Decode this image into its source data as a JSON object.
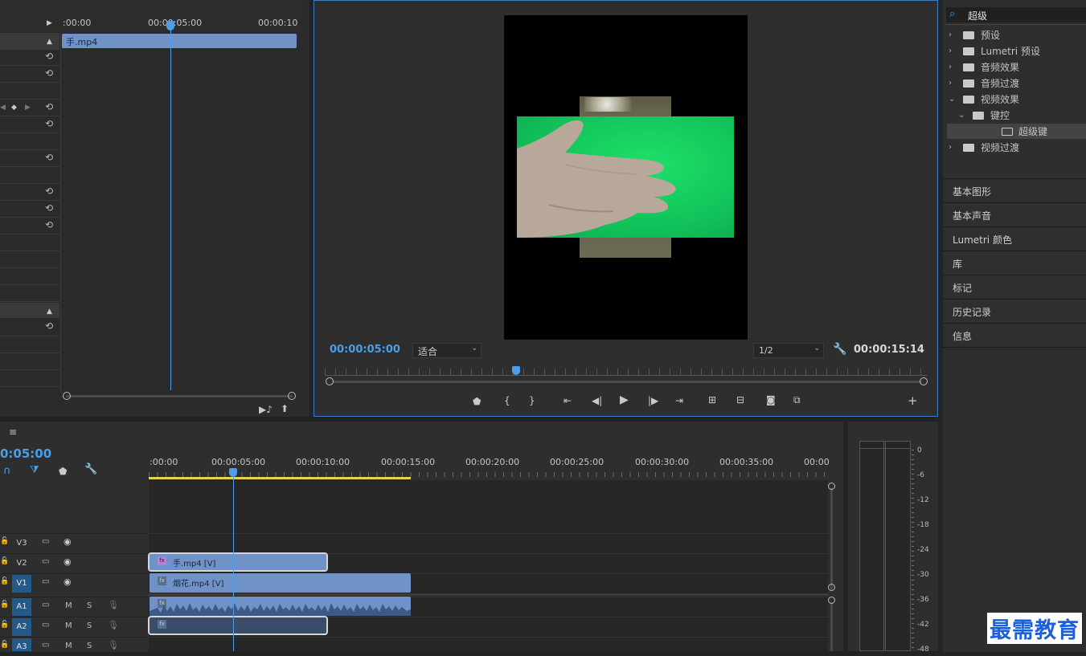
{
  "effect_controls": {
    "ruler": {
      "t0": ":00:00",
      "t5": "00:00:05:00",
      "t10": "00:00:10"
    },
    "clip_name": "手.mp4"
  },
  "program_monitor": {
    "timecode_current": "00:00:05:00",
    "fit_select": "适合",
    "resolution_select": "1/2",
    "timecode_duration": "00:00:15:14"
  },
  "effects_panel": {
    "search_value": "超级",
    "items": [
      {
        "label": "预设",
        "indent": 0
      },
      {
        "label": "Lumetri 预设",
        "indent": 0
      },
      {
        "label": "音频效果",
        "indent": 0
      },
      {
        "label": "音频过渡",
        "indent": 0
      },
      {
        "label": "视频效果",
        "indent": 0
      },
      {
        "label": "键控",
        "indent": 1
      },
      {
        "label": "超级键",
        "indent": 2
      },
      {
        "label": "视频过渡",
        "indent": 0
      }
    ]
  },
  "side_panels": [
    "基本图形",
    "基本声音",
    "Lumetri 颜色",
    "库",
    "标记",
    "历史记录",
    "信息"
  ],
  "timeline": {
    "timecode": "0:05:00",
    "ruler_labels": [
      ":00:00",
      "00:00:05:00",
      "00:00:10:00",
      "00:00:15:00",
      "00:00:20:00",
      "00:00:25:00",
      "00:00:30:00",
      "00:00:35:00",
      "00:00"
    ],
    "tracks": [
      {
        "label": "V3",
        "m": "",
        "s": ""
      },
      {
        "label": "V2",
        "m": "",
        "s": ""
      },
      {
        "label": "V1",
        "m": "",
        "s": ""
      },
      {
        "label": "A1",
        "m": "M",
        "s": "S"
      },
      {
        "label": "A2",
        "m": "M",
        "s": "S"
      },
      {
        "label": "A3",
        "m": "M",
        "s": "S"
      }
    ],
    "clips": {
      "v2": "手.mp4 [V]",
      "v1": "烟花.mp4 [V]"
    }
  },
  "audio_meter": {
    "labels": [
      "0",
      "-6",
      "-12",
      "-18",
      "-24",
      "-30",
      "-36",
      "-42",
      "-48"
    ]
  },
  "watermark": "最需教育",
  "colors": {
    "accent": "#4a9fe8",
    "clip_blue": "#6f93c8",
    "work_area": "#e8d24a"
  }
}
